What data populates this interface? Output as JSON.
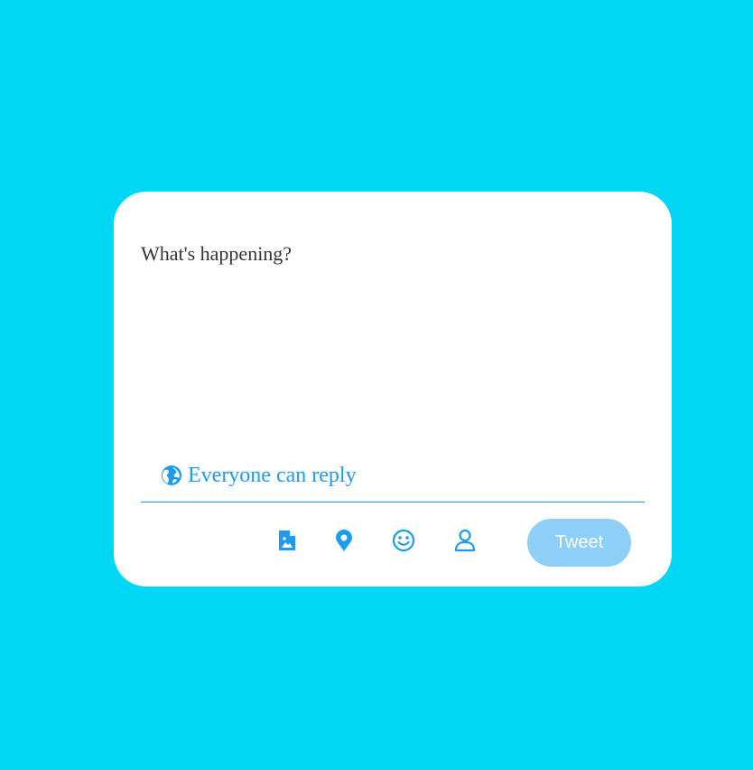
{
  "colors": {
    "page_background": "#00d7f5",
    "card_background": "#ffffff",
    "accent": "#1d9bf0",
    "tweet_button_disabled": "#8ecff7",
    "text": "#333333"
  },
  "composer": {
    "placeholder": "What's happening?",
    "value": "",
    "reply_setting": {
      "icon": "globe-icon",
      "label": "Everyone can reply"
    },
    "toolbar": {
      "tools": [
        {
          "name": "media",
          "icon": "image-file-icon"
        },
        {
          "name": "location",
          "icon": "map-pin-icon"
        },
        {
          "name": "emoji",
          "icon": "smiley-icon"
        },
        {
          "name": "tag-people",
          "icon": "user-icon"
        }
      ],
      "tweet_label": "Tweet"
    }
  }
}
